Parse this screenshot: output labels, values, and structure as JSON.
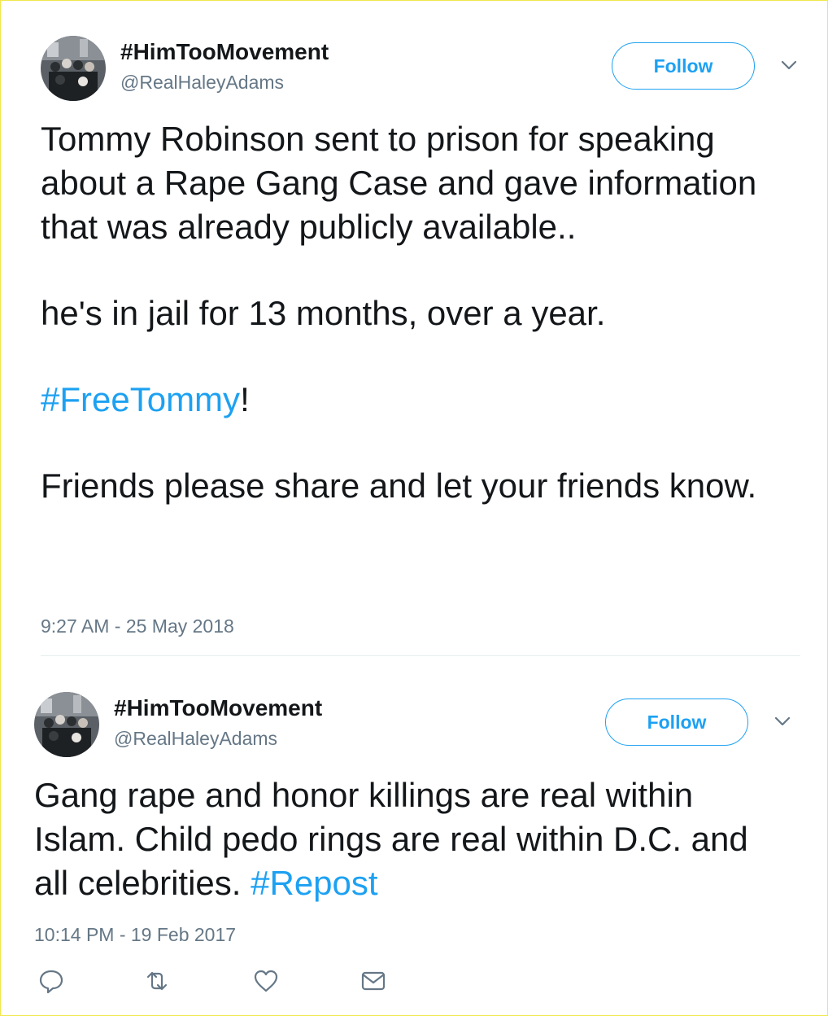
{
  "tweets": [
    {
      "display_name": "#HimTooMovement",
      "handle": "@RealHaleyAdams",
      "follow_label": "Follow",
      "avatar_icon": "group-photo-avatar",
      "menu_icon": "chevron-down-icon",
      "text_paragraphs": [
        "Tommy Robinson sent to prison for speaking about a Rape Gang Case and gave information that was already publicly available..",
        "he's in jail for 13 months, over a year.",
        {
          "hashtag": "#FreeTommy",
          "suffix": "!"
        },
        "Friends please share and let your friends know."
      ],
      "timestamp": "9:27 AM - 25 May 2018"
    },
    {
      "display_name": "#HimTooMovement",
      "handle": "@RealHaleyAdams",
      "follow_label": "Follow",
      "avatar_icon": "group-photo-avatar",
      "menu_icon": "chevron-down-icon",
      "text_main": "Gang rape and honor killings are real within Islam. Child pedo rings are real within D.C. and all celebrities.",
      "text_hashtag": "#Repost",
      "timestamp": "10:14 PM - 19 Feb 2017",
      "actions": [
        "reply-icon",
        "retweet-icon",
        "like-icon",
        "message-icon"
      ]
    }
  ],
  "colors": {
    "accent": "#1da1f2",
    "text": "#14171a",
    "muted": "#657786",
    "frame": "#f0e74a"
  }
}
